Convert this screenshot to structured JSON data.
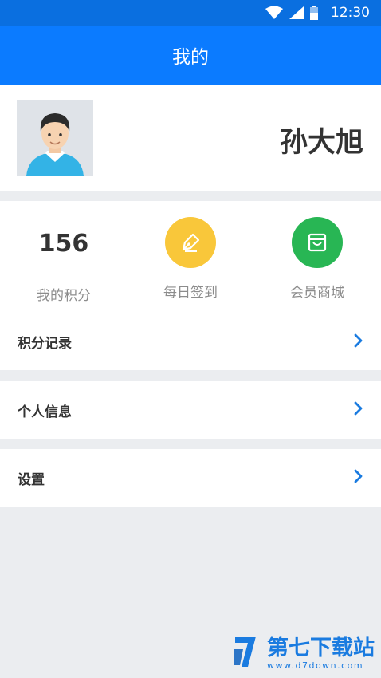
{
  "status_bar": {
    "time": "12:30"
  },
  "app_bar": {
    "title": "我的"
  },
  "profile": {
    "name": "孙大旭"
  },
  "stats": {
    "points_value": "156",
    "points_label": "我的积分",
    "checkin_label": "每日签到",
    "mall_label": "会员商城",
    "checkin_color": "#f9c73a",
    "mall_color": "#28b654"
  },
  "menu": {
    "points_record": "积分记录",
    "personal_info": "个人信息",
    "settings": "设置"
  },
  "watermark": {
    "name": "第七下载站",
    "url": "www.d7down.com"
  },
  "colors": {
    "primary": "#0b7bff",
    "chevron": "#1a7be0"
  }
}
